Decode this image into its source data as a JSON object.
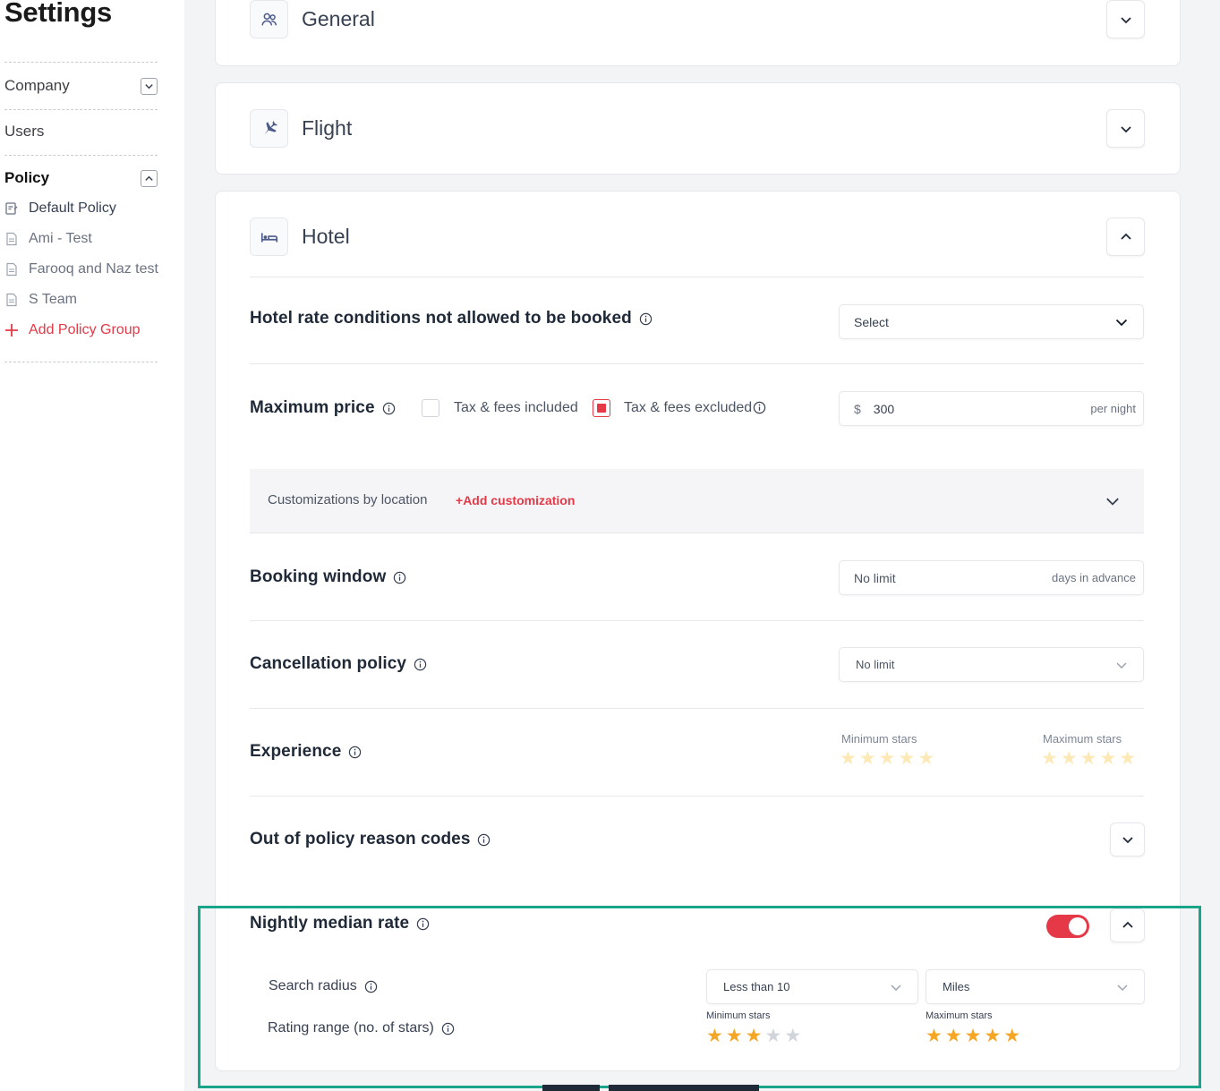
{
  "sidebar": {
    "title": "Settings",
    "items": [
      {
        "label": "Company"
      },
      {
        "label": "Users"
      },
      {
        "label": "Policy"
      }
    ],
    "policy_items": [
      {
        "label": "Default Policy",
        "icon": "policy-doc-icon"
      },
      {
        "label": "Ami - Test",
        "icon": "document-icon"
      },
      {
        "label": "Farooq and Naz test",
        "icon": "document-icon"
      },
      {
        "label": "S Team",
        "icon": "document-icon"
      }
    ],
    "add_policy_group": "Add Policy Group"
  },
  "sections": {
    "general": {
      "title": "General",
      "icon": "people-icon"
    },
    "flight": {
      "title": "Flight",
      "icon": "plane-icon"
    },
    "hotel": {
      "title": "Hotel",
      "icon": "bed-icon"
    }
  },
  "hotel": {
    "rate_conditions": {
      "label": "Hotel rate conditions not allowed to be booked",
      "value": "Select"
    },
    "max_price": {
      "label": "Maximum price",
      "tax_included": "Tax & fees included",
      "tax_excluded": "Tax & fees excluded",
      "currency": "$",
      "value": "300",
      "suffix": "per night"
    },
    "customizations": {
      "label": "Customizations by location",
      "add": "Add customization"
    },
    "booking_window": {
      "label": "Booking window",
      "value": "No limit",
      "suffix": "days in advance"
    },
    "cancellation": {
      "label": "Cancellation policy",
      "value": "No limit"
    },
    "experience": {
      "label": "Experience",
      "min_label": "Minimum stars",
      "max_label": "Maximum stars",
      "min_stars": 0,
      "max_stars": 0
    },
    "reason_codes": {
      "label": "Out of policy reason codes"
    },
    "nightly_median": {
      "label": "Nightly median rate",
      "enabled": true,
      "search_radius": {
        "label": "Search radius",
        "value": "Less than 10",
        "unit": "Miles"
      },
      "rating_range": {
        "label": "Rating range (no. of stars)",
        "min_label": "Minimum stars",
        "max_label": "Maximum stars",
        "min_stars": 3,
        "max_stars": 5
      }
    }
  },
  "colors": {
    "accent": "#e53947",
    "star_on": "#f5a623",
    "star_off": "#d1d5db",
    "star_faded": "#fde9b6",
    "highlight": "#18a589"
  }
}
